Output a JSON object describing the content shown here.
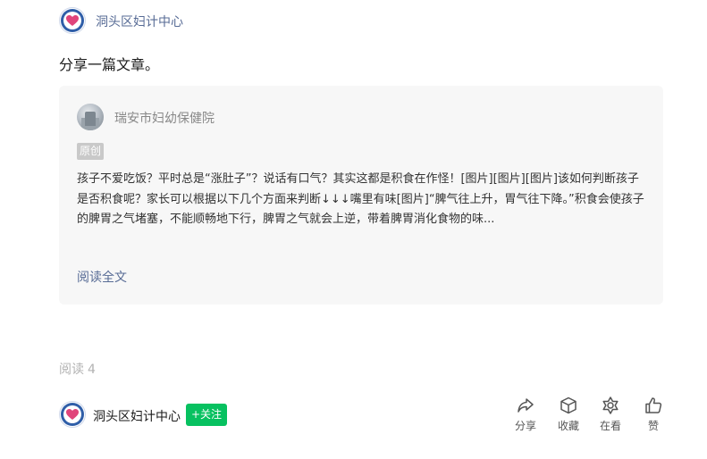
{
  "header": {
    "account_name": "洞头区妇计中心"
  },
  "post": {
    "text": "分享一篇文章。"
  },
  "shared_article": {
    "account_name": "瑞安市妇幼保健院",
    "badge": "原创",
    "excerpt": "孩子不爱吃饭？平时总是“涨肚子”？说话有口气？其实这都是积食在作怪！[图片][图片][图片]该如何判断孩子是否积食呢？家长可以根据以下几个方面来判断↓↓↓嘴里有味[图片]“脾气往上升，胃气往下降。”积食会使孩子的脾胃之气堵塞，不能顺畅地下行，脾胃之气就会上逆，带着脾胃消化食物的味...",
    "read_full": "阅读全文"
  },
  "stats": {
    "read_label": "阅读",
    "read_count": "4"
  },
  "footer": {
    "account_name": "洞头区妇计中心",
    "follow_label": "+关注",
    "actions": [
      {
        "label": "分享",
        "icon": "share-icon"
      },
      {
        "label": "收藏",
        "icon": "collect-icon"
      },
      {
        "label": "在看",
        "icon": "wow-icon"
      },
      {
        "label": "赞",
        "icon": "like-icon"
      }
    ]
  },
  "colors": {
    "link": "#576b95",
    "follow": "#07c160",
    "card_bg": "#f7f7f7"
  }
}
